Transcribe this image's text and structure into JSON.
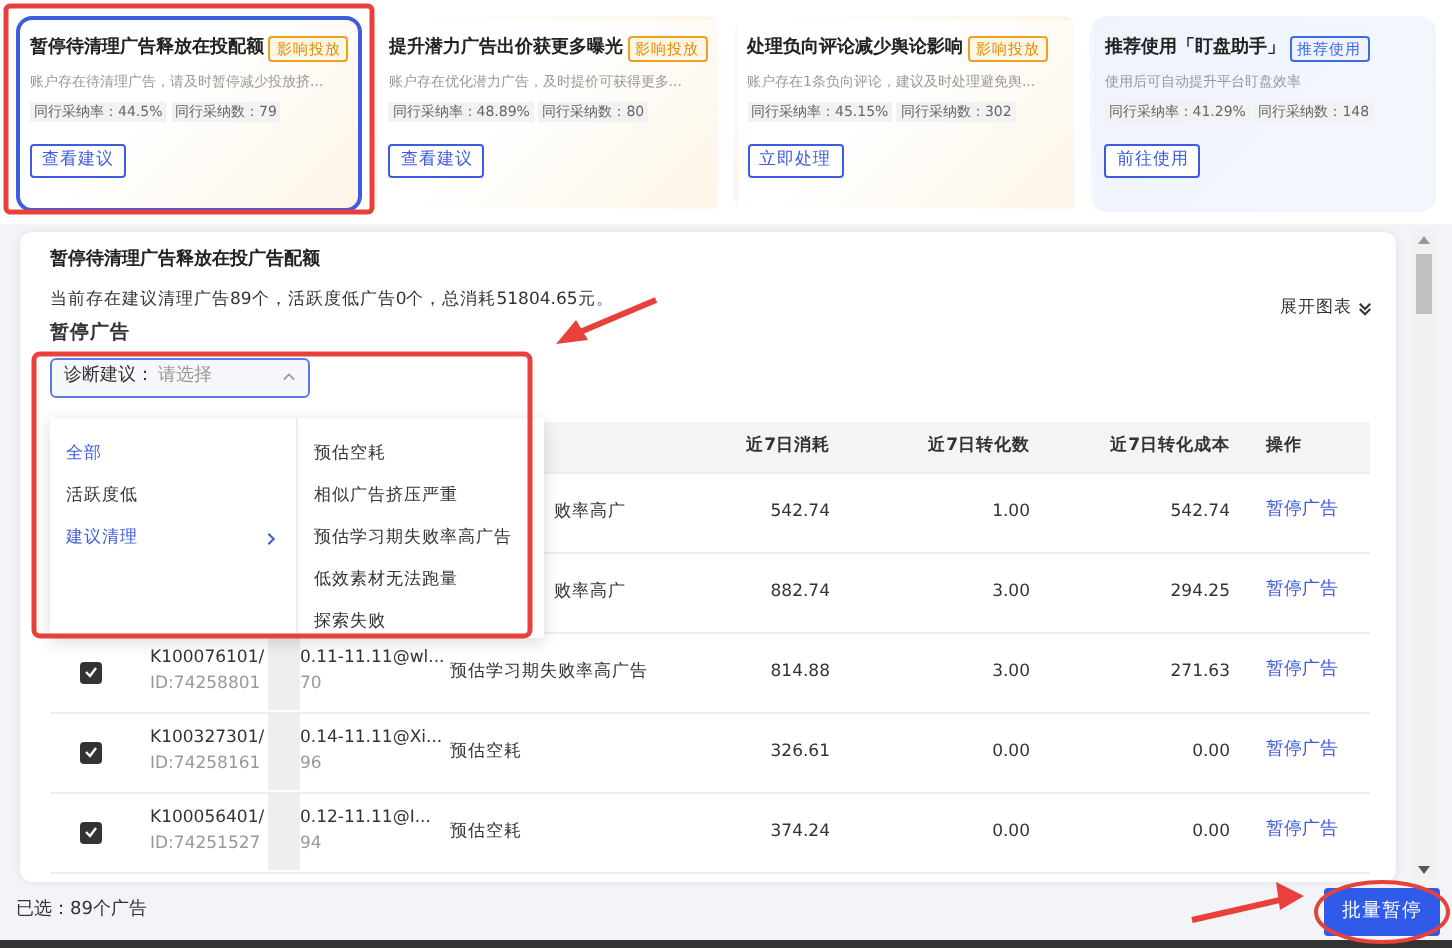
{
  "suggestion_cards": [
    {
      "title": "暂停待清理广告释放在投配额",
      "tag": "影响投放",
      "kind": "warn",
      "description": "账户存在待清理广告，请及时暂停减少投放挤...",
      "adoption_rate": "同行采纳率：44.5%",
      "adoption_count": "同行采纳数：79",
      "button": "查看建议",
      "selected": true
    },
    {
      "title": "提升潜力广告出价获更多曝光",
      "tag": "影响投放",
      "kind": "warn",
      "description": "账户存在优化潜力广告，及时提价可获得更多...",
      "adoption_rate": "同行采纳率：48.89%",
      "adoption_count": "同行采纳数：80",
      "button": "查看建议",
      "selected": false
    },
    {
      "title": "处理负向评论减少舆论影响",
      "tag": "影响投放",
      "kind": "warn",
      "description": "账户存在1条负向评论，建议及时处理避免舆...",
      "adoption_rate": "同行采纳率：45.15%",
      "adoption_count": "同行采纳数：302",
      "button": "立即处理",
      "selected": false
    },
    {
      "title": "推荐使用「盯盘助手」",
      "tag": "推荐使用",
      "kind": "info",
      "description": "使用后可自动提升平台盯盘效率",
      "adoption_rate": "同行采纳率：41.29%",
      "adoption_count": "同行采纳数：148",
      "button": "前往使用",
      "selected": false
    }
  ],
  "panel": {
    "title": "暂停待清理广告释放在投广告配额",
    "summary": "当前存在建议清理广告89个，活跃度低广告0个，总消耗51804.65元。",
    "expand_link": "展开图表",
    "section_title": "暂停广告",
    "filter": {
      "label": "诊断建议：",
      "placeholder": "请选择",
      "expanded": true
    },
    "dropdown": {
      "categories": [
        {
          "label": "全部",
          "selected": true,
          "has_children": false
        },
        {
          "label": "活跃度低",
          "selected": false,
          "has_children": false
        },
        {
          "label": "建议清理",
          "selected": true,
          "has_children": true
        }
      ],
      "options": [
        "预估空耗",
        "相似广告挤压严重",
        "预估学习期失败率高广告",
        "低效素材无法跑量",
        "探索失败"
      ]
    },
    "table": {
      "columns": [
        "近7日消耗",
        "近7日转化数",
        "近7日转化成本",
        "操作"
      ],
      "rows": [
        {
          "diagnosis": "败率高广",
          "spend": "542.74",
          "conversions": "1.00",
          "cost": "542.74",
          "action": "暂停广告"
        },
        {
          "diagnosis": "败率高广",
          "spend": "882.74",
          "conversions": "3.00",
          "cost": "294.25",
          "action": "暂停广告"
        },
        {
          "checked": true,
          "name": "K100076101/",
          "id": "ID:74258801",
          "plan": "0.11-11.11@wl...",
          "plan_sub": "70",
          "diagnosis": "预估学习期失败率高广告",
          "spend": "814.88",
          "conversions": "3.00",
          "cost": "271.63",
          "action": "暂停广告"
        },
        {
          "checked": true,
          "name": "K100327301/",
          "id": "ID:74258161",
          "plan": "0.14-11.11@Xi...",
          "plan_sub": "96",
          "diagnosis": "预估空耗",
          "spend": "326.61",
          "conversions": "0.00",
          "cost": "0.00",
          "action": "暂停广告"
        },
        {
          "checked": true,
          "name": "K100056401/",
          "id": "ID:74251527",
          "plan": "0.12-11.11@I...",
          "plan_sub": "94",
          "diagnosis": "预估空耗",
          "spend": "374.24",
          "conversions": "0.00",
          "cost": "0.00",
          "action": "暂停广告"
        }
      ]
    }
  },
  "footer": {
    "selected_count": "已选：89个广告",
    "button": "批量暂停"
  }
}
